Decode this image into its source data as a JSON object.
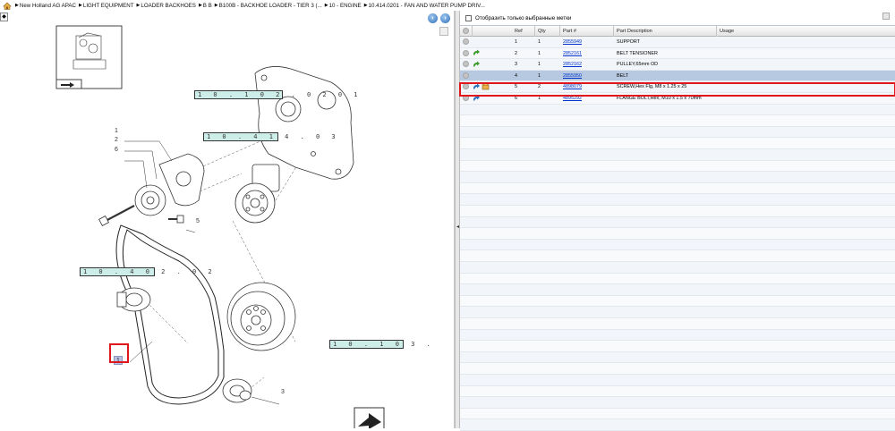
{
  "breadcrumb": {
    "items": [
      "New Holland AG APAC",
      "LIGHT EQUIPMENT",
      "LOADER BACKHOES",
      "B B",
      "B100B - BACKHOE LOADER - TIER 3 (...",
      "10 - ENGINE",
      "10.414.0201 - FAN AND WATER PUMP DRIV..."
    ]
  },
  "diagram": {
    "ref_labels": [
      "1 0 . 1 0 2 . 0 2 0 1",
      "1 0 . 4 1 4 . 0 3",
      "1 0 . 4 0 2 . 0 2",
      "1 0 . 1 0 3 ."
    ],
    "callouts": [
      "1",
      "2",
      "6",
      "5",
      "3"
    ],
    "hotspot_1": "1"
  },
  "filter": {
    "label": "Отобразить только выбранные метки",
    "checked": false
  },
  "grid": {
    "columns": [
      "Ref",
      "Qty",
      "Part #",
      "Part Description",
      "Usage"
    ],
    "rows": [
      {
        "ref": "1",
        "qty": "1",
        "part": "2855949",
        "desc": "SUPPORT",
        "usage": "",
        "icon": "circle"
      },
      {
        "ref": "2",
        "qty": "1",
        "part": "2852161",
        "desc": "BELT TENSIONER",
        "usage": "",
        "icon": "green-arrow"
      },
      {
        "ref": "3",
        "qty": "1",
        "part": "2852162",
        "desc": "PULLEY,65mm OD",
        "usage": "",
        "icon": "green-arrow"
      },
      {
        "ref": "4",
        "qty": "1",
        "part": "2855950",
        "desc": "BELT",
        "usage": "",
        "icon": "circle"
      },
      {
        "ref": "5",
        "qty": "2",
        "part": "4898079",
        "desc": "SCREW,Hex Flg, M8 x 1.25 x 25",
        "usage": "",
        "icon": "blue-arrow-box"
      },
      {
        "ref": "6",
        "qty": "1",
        "part": "4895292",
        "desc": "FLANGE BOLT,Hex, M10 x 1.5 x 70mm",
        "usage": "",
        "icon": "blue-arrow"
      }
    ]
  },
  "colors": {
    "selection": "#b7c8e1",
    "highlight": "#e0161d",
    "label_fill": "#cdeee8",
    "link": "#0033cc"
  }
}
